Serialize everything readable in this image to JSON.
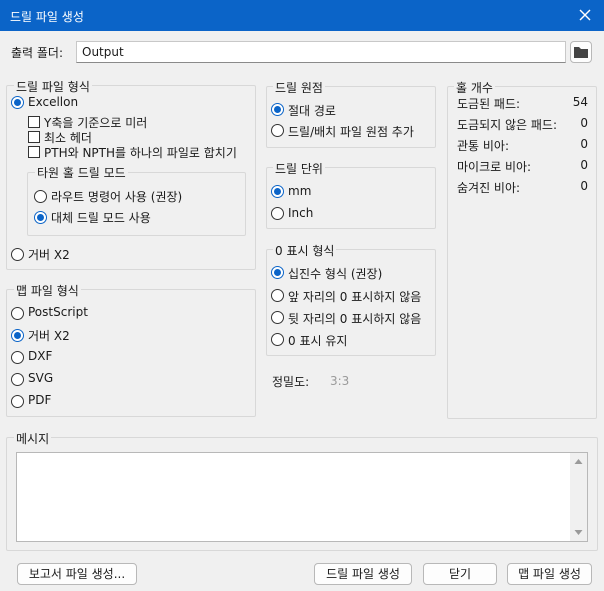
{
  "window": {
    "title": "드릴 파일 생성",
    "close_glyph": "✕"
  },
  "output": {
    "label": "출력 폴더:",
    "value": "Output",
    "folder_icon": "folder-icon"
  },
  "drill_format": {
    "title": "드릴 파일 형식",
    "excellon": "Excellon",
    "mirror_y": "Y축을 기준으로 미러",
    "min_header": "최소 헤더",
    "merge_pth": "PTH와 NPTH를 하나의 파일로 합치기",
    "oval_group": {
      "title": "타원 홀 드릴 모드",
      "route": "라우트 명령어 사용 (권장)",
      "alternate": "대체 드릴 모드 사용"
    },
    "gerber_x2": "거버 X2"
  },
  "map_format": {
    "title": "맵 파일 형식",
    "options": [
      "PostScript",
      "거버 X2",
      "DXF",
      "SVG",
      "PDF"
    ]
  },
  "drill_origin": {
    "title": "드릴 원점",
    "absolute": "절대 경로",
    "aux": "드릴/배치 파일 원점 추가"
  },
  "drill_units": {
    "title": "드릴 단위",
    "mm": "mm",
    "inch": "Inch"
  },
  "zeros": {
    "title": "0 표시 형식",
    "decimal": "십진수 형식 (권장)",
    "suppress_leading": "앞 자리의 0 표시하지 않음",
    "suppress_trailing": "뒷 자리의 0 표시하지 않음",
    "keep": "0 표시 유지"
  },
  "precision": {
    "label": "정밀도:",
    "value": "3:3"
  },
  "hole_counts": {
    "title": "홀 개수",
    "rows": [
      {
        "label": "도금된 패드:",
        "value": "54"
      },
      {
        "label": "도금되지 않은 패드:",
        "value": "0"
      },
      {
        "label": "관통 비아:",
        "value": "0"
      },
      {
        "label": "마이크로 비아:",
        "value": "0"
      },
      {
        "label": "숨겨진 비아:",
        "value": "0"
      }
    ]
  },
  "messages": {
    "title": "메시지"
  },
  "buttons": {
    "report": "보고서 파일 생성...",
    "gen_drill": "드릴 파일 생성",
    "close": "닫기",
    "gen_map": "맵 파일 생성"
  }
}
